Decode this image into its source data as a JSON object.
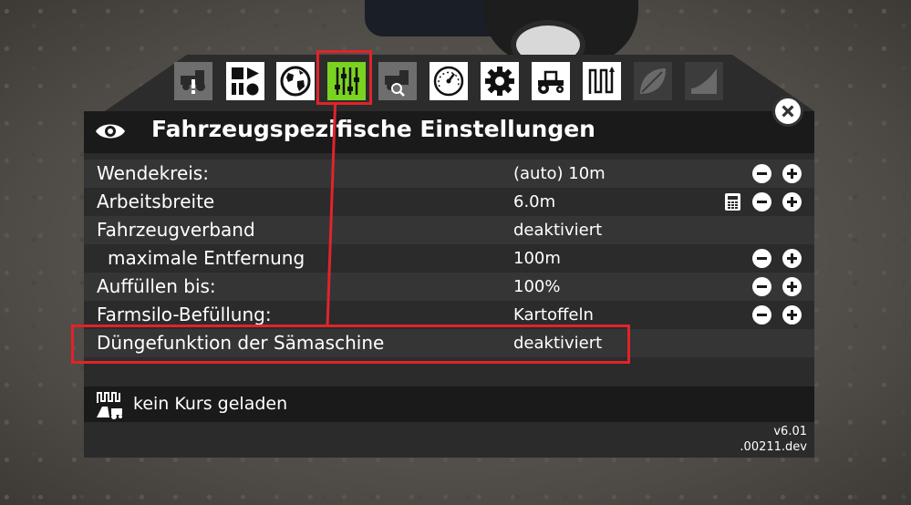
{
  "panel": {
    "title": "Fahrzeugspezifische Einstellungen",
    "close_icon": "close-icon"
  },
  "toolbar": {
    "tabs": [
      {
        "name": "tab-vehicle-warning",
        "icon": "vehicle-warning-icon",
        "style": "grey"
      },
      {
        "name": "tab-shapes",
        "icon": "shapes-icon",
        "style": "white"
      },
      {
        "name": "tab-globe",
        "icon": "globe-icon",
        "style": "white"
      },
      {
        "name": "tab-vehicle-settings",
        "icon": "sliders-icon",
        "style": "active"
      },
      {
        "name": "tab-vehicle-search",
        "icon": "vehicle-search-icon",
        "style": "grey"
      },
      {
        "name": "tab-speedometer",
        "icon": "speedometer-icon",
        "style": "white"
      },
      {
        "name": "tab-gear",
        "icon": "gear-icon",
        "style": "white"
      },
      {
        "name": "tab-tractor",
        "icon": "tractor-icon",
        "style": "white"
      },
      {
        "name": "tab-course",
        "icon": "course-icon",
        "style": "white"
      },
      {
        "name": "tab-leaf",
        "icon": "leaf-icon",
        "style": "faded"
      },
      {
        "name": "tab-field",
        "icon": "field-icon",
        "style": "faded"
      }
    ]
  },
  "settings": {
    "rows": [
      {
        "label": "Wendekreis:",
        "value": "(auto) 10m"
      },
      {
        "label": "Arbeitsbreite",
        "value": "6.0m"
      },
      {
        "label": "Fahrzeugverband",
        "value": "deaktiviert"
      },
      {
        "label": "maximale Entfernung",
        "value": "100m"
      },
      {
        "label": "Auffüllen bis:",
        "value": "100%"
      },
      {
        "label": "Farmsilo-Befüllung:",
        "value": "Kartoffeln"
      },
      {
        "label": "Düngefunktion der Sämaschine",
        "value": "deaktiviert"
      }
    ]
  },
  "course": {
    "status": "kein Kurs geladen"
  },
  "version": {
    "line1": "v6.01",
    "line2": ".00211.dev"
  },
  "colors": {
    "active_tab": "#7bd321",
    "highlight": "#e2232a",
    "panel_bg": "#2b2b2b",
    "header_bg": "#1a1a1a"
  }
}
